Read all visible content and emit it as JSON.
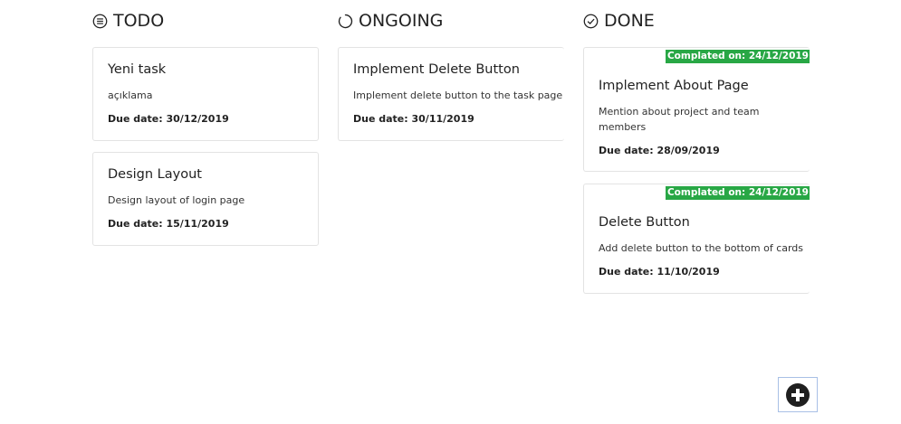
{
  "columns": {
    "todo": {
      "title": "TODO",
      "icon": "list-circle-icon"
    },
    "ongoing": {
      "title": "ONGOING",
      "icon": "spinner-icon"
    },
    "done": {
      "title": "DONE",
      "icon": "check-circle-icon"
    }
  },
  "todo_cards": [
    {
      "title": "Yeni task",
      "description": "açıklama",
      "due": "Due date: 30/12/2019"
    },
    {
      "title": "Design Layout",
      "description": "Design layout of login page",
      "due": "Due date: 15/11/2019"
    }
  ],
  "ongoing_cards": [
    {
      "title": "Implement Delete Button",
      "description": "Implement delete button to the task page",
      "due": "Due date: 30/11/2019"
    }
  ],
  "done_cards": [
    {
      "badge": "Complated on: 24/12/2019",
      "title": "Implement About Page",
      "description": "Mention about project and team members",
      "due": "Due date: 28/09/2019"
    },
    {
      "badge": "Complated on: 24/12/2019",
      "title": "Delete Button",
      "description": "Add delete button to the bottom of cards",
      "due": "Due date: 11/10/2019"
    }
  ],
  "add_button": {
    "icon": "plus-circle-icon"
  },
  "colors": {
    "badge": "#28a745",
    "border": "#e3e3e3",
    "add_border": "#a8c0e6"
  }
}
